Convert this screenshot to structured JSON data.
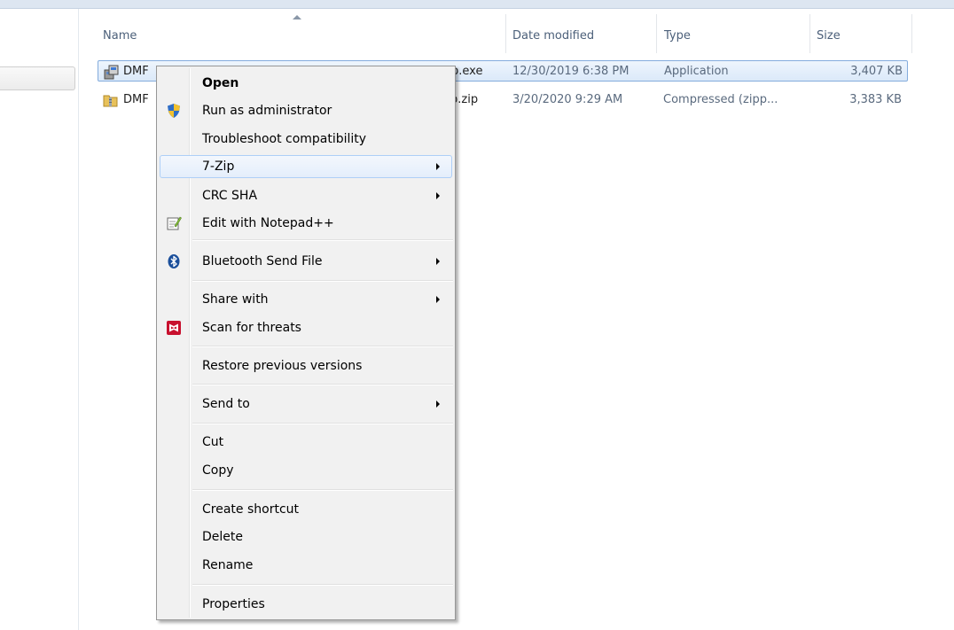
{
  "columns": {
    "name": "Name",
    "date_modified": "Date modified",
    "type": "Type",
    "size": "Size"
  },
  "files": [
    {
      "name_start": "DMF",
      "name_end": "p.exe",
      "date": "12/30/2019 6:38 PM",
      "type": "Application",
      "size": "3,407 KB",
      "icon": "application-icon",
      "selected": true
    },
    {
      "name_start": "DMF",
      "name_end": "p.zip",
      "date": "3/20/2020 9:29 AM",
      "type": "Compressed (zipp...",
      "size": "3,383 KB",
      "icon": "zip-folder-icon",
      "selected": false
    }
  ],
  "context_menu": {
    "items": [
      {
        "label": "Open",
        "bold": true
      },
      {
        "label": "Run as administrator",
        "icon": "uac-shield-icon"
      },
      {
        "label": "Troubleshoot compatibility"
      },
      {
        "label": "7-Zip",
        "submenu": true,
        "highlighted": true
      },
      {
        "label": "CRC SHA",
        "submenu": true
      },
      {
        "label": "Edit with Notepad++",
        "icon": "notepad-plus-plus-icon"
      },
      {
        "label": "Bluetooth Send File",
        "icon": "bluetooth-icon",
        "submenu": true
      },
      {
        "label": "Share with",
        "submenu": true
      },
      {
        "label": "Scan for threats",
        "icon": "mcafee-icon"
      },
      {
        "label": "Restore previous versions"
      },
      {
        "label": "Send to",
        "submenu": true
      },
      {
        "label": "Cut"
      },
      {
        "label": "Copy"
      },
      {
        "label": "Create shortcut"
      },
      {
        "label": "Delete"
      },
      {
        "label": "Rename"
      },
      {
        "label": "Properties"
      }
    ]
  },
  "colors": {
    "selection_border": "#84acdd",
    "menu_background": "#f1f1f1",
    "header_text": "#4c607a"
  }
}
